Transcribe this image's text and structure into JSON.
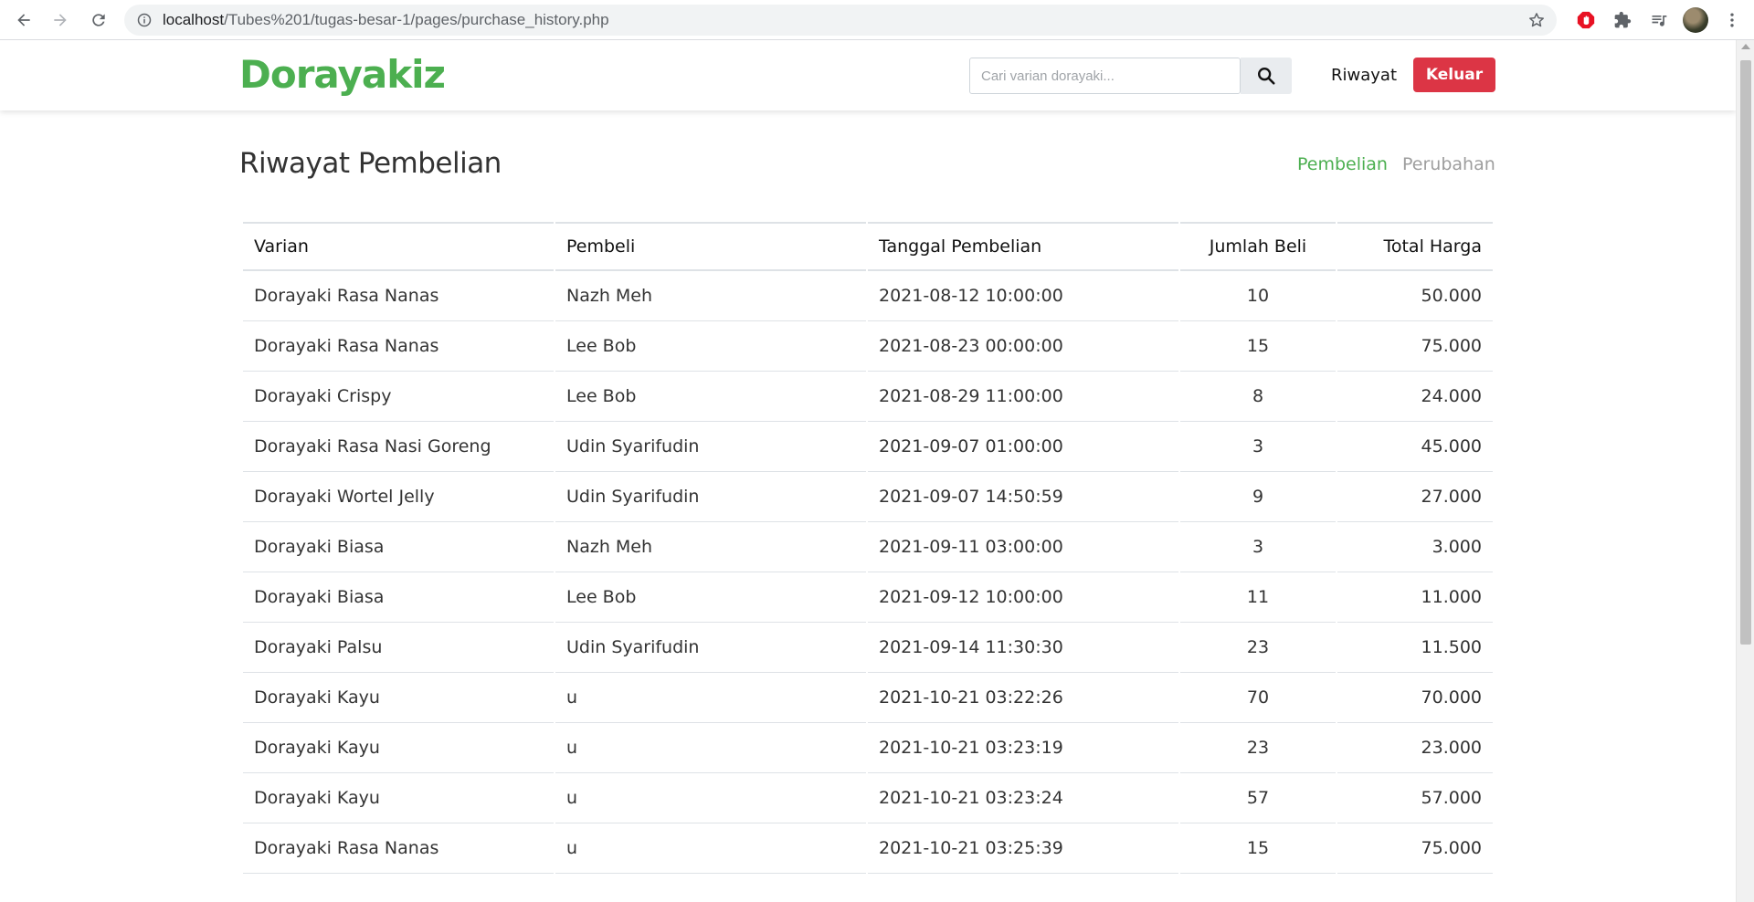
{
  "browser": {
    "url_host": "localhost",
    "url_path": "/Tubes%201/tugas-besar-1/pages/purchase_history.php"
  },
  "header": {
    "logo": "Dorayakiz",
    "search_placeholder": "Cari varian dorayaki...",
    "riwayat_label": "Riwayat",
    "keluar_label": "Keluar"
  },
  "main": {
    "title": "Riwayat Pembelian",
    "tabs": [
      "Pembelian",
      "Perubahan"
    ],
    "columns": [
      "Varian",
      "Pembeli",
      "Tanggal Pembelian",
      "Jumlah Beli",
      "Total Harga"
    ],
    "rows": [
      [
        "Dorayaki Rasa Nanas",
        "Nazh Meh",
        "2021-08-12 10:00:00",
        "10",
        "50.000"
      ],
      [
        "Dorayaki Rasa Nanas",
        "Lee Bob",
        "2021-08-23 00:00:00",
        "15",
        "75.000"
      ],
      [
        "Dorayaki Crispy",
        "Lee Bob",
        "2021-08-29 11:00:00",
        "8",
        "24.000"
      ],
      [
        "Dorayaki Rasa Nasi Goreng",
        "Udin Syarifudin",
        "2021-09-07 01:00:00",
        "3",
        "45.000"
      ],
      [
        "Dorayaki Wortel Jelly",
        "Udin Syarifudin",
        "2021-09-07 14:50:59",
        "9",
        "27.000"
      ],
      [
        "Dorayaki Biasa",
        "Nazh Meh",
        "2021-09-11 03:00:00",
        "3",
        "3.000"
      ],
      [
        "Dorayaki Biasa",
        "Lee Bob",
        "2021-09-12 10:00:00",
        "11",
        "11.000"
      ],
      [
        "Dorayaki Palsu",
        "Udin Syarifudin",
        "2021-09-14 11:30:30",
        "23",
        "11.500"
      ],
      [
        "Dorayaki Kayu",
        "u",
        "2021-10-21 03:22:26",
        "70",
        "70.000"
      ],
      [
        "Dorayaki Kayu",
        "u",
        "2021-10-21 03:23:19",
        "23",
        "23.000"
      ],
      [
        "Dorayaki Kayu",
        "u",
        "2021-10-21 03:23:24",
        "57",
        "57.000"
      ],
      [
        "Dorayaki Rasa Nanas",
        "u",
        "2021-10-21 03:25:39",
        "15",
        "75.000"
      ]
    ]
  },
  "colors": {
    "brand_green": "#4caf50",
    "danger_red": "#dc3545",
    "muted_gray": "#9e9e9e"
  }
}
